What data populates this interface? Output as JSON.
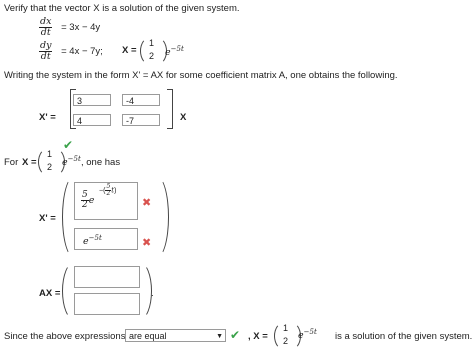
{
  "intro_text": "Verify that the vector X is a solution of the given system.",
  "system": {
    "eq1_lhs_num": "dx",
    "eq1_lhs_den": "dt",
    "eq1_rhs": "= 3x − 4y",
    "eq2_lhs_num": "dy",
    "eq2_lhs_den": "dt",
    "eq2_rhs": "= 4x − 7y;",
    "x_label": "X =",
    "vec_top": "1",
    "vec_bottom": "2",
    "exp": "e",
    "exp_power": "−5t"
  },
  "form_text": "Writing the system in the form  X' = AX  for some coefficient matrix A, one obtains the following.",
  "matrix": {
    "lhs_label": "X' =",
    "a11": "3",
    "a12": "-4",
    "a21": "4",
    "a22": "-7",
    "rhs_label": "X"
  },
  "for_line": {
    "prefix": "For",
    "x_label": "X =",
    "vec_top": "1",
    "vec_bottom": "2",
    "exp": "e",
    "exp_power": "−5t",
    "suffix": ",  one has"
  },
  "xprime": {
    "label": "X' =",
    "entry1_coef_num": "5",
    "entry1_coef_den": "2",
    "entry1_exp": "e",
    "entry1_power_num": "5",
    "entry1_power_den": "2",
    "entry1_power_var": "t",
    "entry1_power_sign": "−",
    "entry2_exp": "e",
    "entry2_power": "−5t"
  },
  "ax": {
    "label": "AX =",
    "period": "."
  },
  "conclusion": {
    "prefix": "Since the above expressions",
    "select_value": "are equal",
    "x_label": ",  X =",
    "vec_top": "1",
    "vec_bottom": "2",
    "exp": "e",
    "exp_power": "−5t",
    "suffix": "is a solution of the given system."
  },
  "colors": {
    "check": "#3aa24a",
    "cross": "#d9534f"
  },
  "icons": {
    "check": "✔",
    "cross": "✖",
    "dropdown": "▼"
  }
}
